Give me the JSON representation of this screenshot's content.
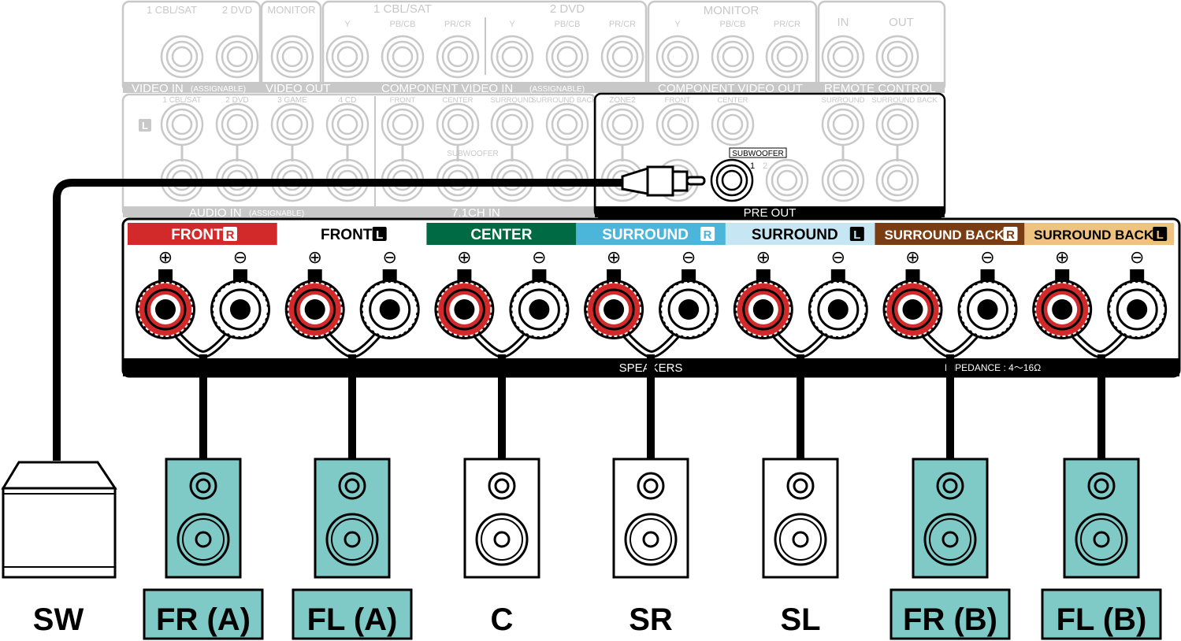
{
  "receiver": {
    "video_in": {
      "label": "VIDEO IN",
      "note": "(ASSIGNABLE)",
      "jacks": [
        "1 CBL/SAT",
        "2 DVD"
      ]
    },
    "video_out": {
      "label": "VIDEO OUT",
      "jacks": [
        "MONITOR"
      ]
    },
    "component_in": {
      "label": "COMPONENT VIDEO IN",
      "note": "(ASSIGNABLE)",
      "groups": [
        "1 CBL/SAT",
        "2 DVD"
      ],
      "jacks": [
        "Y",
        "PB/CB",
        "PR/CR",
        "Y",
        "PB/CB",
        "PR/CR"
      ]
    },
    "component_out": {
      "label": "COMPONENT VIDEO OUT",
      "group": "MONITOR",
      "jacks": [
        "Y",
        "PB/CB",
        "PR/CR"
      ]
    },
    "remote": {
      "label": "REMOTE CONTROL",
      "jacks": [
        "IN",
        "OUT"
      ]
    },
    "audio_in": {
      "label": "AUDIO IN",
      "note": "(ASSIGNABLE)",
      "side": "L",
      "jacks": [
        "1 CBL/SAT",
        "2 DVD",
        "3 GAME",
        "4 CD"
      ]
    },
    "ch71_in": {
      "label": "7.1CH IN",
      "jacks": [
        "FRONT",
        "CENTER",
        "SURROUND",
        "SURROUND BACK"
      ],
      "sub": "SUBWOOFER"
    },
    "zone2": "ZONE2",
    "pre_out": {
      "label": "PRE OUT",
      "jacks": [
        "FRONT",
        "CENTER",
        "SURROUND",
        "SURROUND BACK"
      ],
      "sub": "SUBWOOFER",
      "sub_nums": [
        "1",
        "2"
      ]
    },
    "speakers_label": "SPEAKERS",
    "impedance": "IMPEDANCE : 4～16Ω"
  },
  "channels": [
    {
      "label": "FRONT",
      "side": "R",
      "bg": "#d22a2a",
      "fg": "#ffffff"
    },
    {
      "label": "FRONT",
      "side": "L",
      "bg": "#ffffff",
      "fg": "#000000"
    },
    {
      "label": "CENTER",
      "side": "",
      "bg": "#006a45",
      "fg": "#ffffff"
    },
    {
      "label": "SURROUND",
      "side": "R",
      "bg": "#4bb6d9",
      "fg": "#ffffff"
    },
    {
      "label": "SURROUND",
      "side": "L",
      "bg": "#c5e6f2",
      "fg": "#000000"
    },
    {
      "label": "SURROUND BACK",
      "side": "R",
      "bg": "#7a3c12",
      "fg": "#ffffff"
    },
    {
      "label": "SURROUND BACK",
      "side": "L",
      "bg": "#efc27f",
      "fg": "#000000"
    }
  ],
  "polarity": {
    "plus": "⊕",
    "minus": "⊖"
  },
  "speakers": [
    {
      "label": "SW",
      "type": "subwoofer",
      "highlight": false
    },
    {
      "label": "FR (A)",
      "highlight": true
    },
    {
      "label": "FL (A)",
      "highlight": true
    },
    {
      "label": "C",
      "highlight": false
    },
    {
      "label": "SR",
      "highlight": false
    },
    {
      "label": "SL",
      "highlight": false
    },
    {
      "label": "FR (B)",
      "highlight": true
    },
    {
      "label": "FL (B)",
      "highlight": true
    }
  ],
  "colors": {
    "highlight": "#7fcac6",
    "terminal_plus": "#d22a2a",
    "panel_gray": "#c8c8c8"
  }
}
